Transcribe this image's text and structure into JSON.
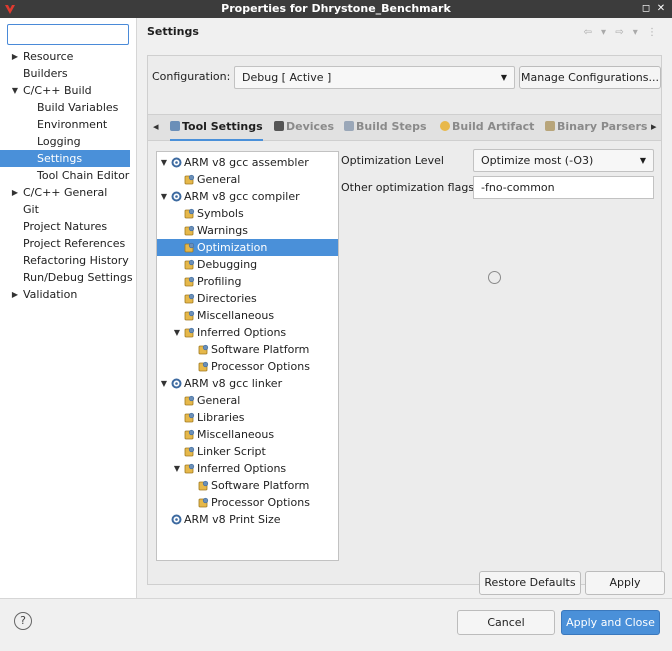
{
  "window": {
    "title": "Properties for Dhrystone_Benchmark",
    "minimize_glyph": "◻",
    "close_glyph": "✕"
  },
  "filter": {
    "value": ""
  },
  "nav": [
    {
      "label": "Resource",
      "twisty": "▶",
      "level": 0
    },
    {
      "label": "Builders",
      "twisty": "",
      "level": 0
    },
    {
      "label": "C/C++ Build",
      "twisty": "▼",
      "level": 0
    },
    {
      "label": "Build Variables",
      "twisty": "",
      "level": 1
    },
    {
      "label": "Environment",
      "twisty": "",
      "level": 1
    },
    {
      "label": "Logging",
      "twisty": "",
      "level": 1
    },
    {
      "label": "Settings",
      "twisty": "",
      "level": 1,
      "selected": true
    },
    {
      "label": "Tool Chain Editor",
      "twisty": "",
      "level": 1
    },
    {
      "label": "C/C++ General",
      "twisty": "▶",
      "level": 0
    },
    {
      "label": "Git",
      "twisty": "",
      "level": 0
    },
    {
      "label": "Project Natures",
      "twisty": "",
      "level": 0
    },
    {
      "label": "Project References",
      "twisty": "",
      "level": 0
    },
    {
      "label": "Refactoring History",
      "twisty": "",
      "level": 0
    },
    {
      "label": "Run/Debug Settings",
      "twisty": "",
      "level": 0
    },
    {
      "label": "Validation",
      "twisty": "▶",
      "level": 0
    }
  ],
  "header": {
    "title": "Settings",
    "tools": "⇦ ▾ ⇨ ▾ ⋮"
  },
  "configuration": {
    "label": "Configuration:",
    "value": "Debug  [ Active ]",
    "manage_label": "Manage Configurations..."
  },
  "tabs": {
    "scroll_left": "◂",
    "scroll_right": "▸",
    "items": [
      {
        "label": "Tool Settings",
        "active": true
      },
      {
        "label": "Devices"
      },
      {
        "label": "Build Steps"
      },
      {
        "label": "Build Artifact"
      },
      {
        "label": "Binary Parsers"
      }
    ]
  },
  "tree": [
    {
      "label": "ARM v8 gcc assembler",
      "level": 0,
      "twisty": "▼",
      "icon": "gear"
    },
    {
      "label": "General",
      "level": 1,
      "icon": "option"
    },
    {
      "label": "ARM v8 gcc compiler",
      "level": 0,
      "twisty": "▼",
      "icon": "gear"
    },
    {
      "label": "Symbols",
      "level": 1,
      "icon": "option"
    },
    {
      "label": "Warnings",
      "level": 1,
      "icon": "option"
    },
    {
      "label": "Optimization",
      "level": 1,
      "icon": "option",
      "selected": true
    },
    {
      "label": "Debugging",
      "level": 1,
      "icon": "option"
    },
    {
      "label": "Profiling",
      "level": 1,
      "icon": "option"
    },
    {
      "label": "Directories",
      "level": 1,
      "icon": "option"
    },
    {
      "label": "Miscellaneous",
      "level": 1,
      "icon": "option"
    },
    {
      "label": "Inferred Options",
      "level": 1,
      "twisty": "▼",
      "icon": "option"
    },
    {
      "label": "Software Platform",
      "level": 2,
      "icon": "option"
    },
    {
      "label": "Processor Options",
      "level": 2,
      "icon": "option"
    },
    {
      "label": "ARM v8 gcc linker",
      "level": 0,
      "twisty": "▼",
      "icon": "gear"
    },
    {
      "label": "General",
      "level": 1,
      "icon": "option"
    },
    {
      "label": "Libraries",
      "level": 1,
      "icon": "option"
    },
    {
      "label": "Miscellaneous",
      "level": 1,
      "icon": "option"
    },
    {
      "label": "Linker Script",
      "level": 1,
      "icon": "option"
    },
    {
      "label": "Inferred Options",
      "level": 1,
      "twisty": "▼",
      "icon": "option"
    },
    {
      "label": "Software Platform",
      "level": 2,
      "icon": "option"
    },
    {
      "label": "Processor Options",
      "level": 2,
      "icon": "option"
    },
    {
      "label": "ARM v8 Print Size",
      "level": 0,
      "icon": "gear"
    }
  ],
  "optimization": {
    "level_label": "Optimization Level",
    "level_value": "Optimize most (-O3)",
    "flags_label": "Other optimization flags",
    "flags_value": "-fno-common"
  },
  "buttons": {
    "restore_defaults": "Restore Defaults",
    "apply": "Apply",
    "cancel": "Cancel",
    "apply_close": "Apply and Close",
    "help": "?"
  },
  "colors": {
    "selection": "#4a90d9",
    "titlebar": "#3c3c3c"
  }
}
